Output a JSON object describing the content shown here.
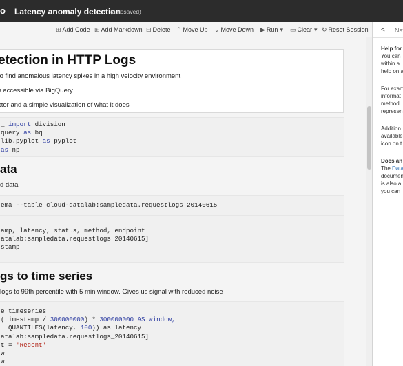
{
  "header": {
    "logo": "o",
    "title": "Latency anomaly detection",
    "autosave": "(autosaved)"
  },
  "toolbar": {
    "add_code": "Add Code",
    "add_markdown": "Add Markdown",
    "delete": "Delete",
    "move_up": "Move Up",
    "move_down": "Move Down",
    "run": "Run",
    "clear": "Clear",
    "reset": "Reset Session"
  },
  "panel": {
    "back": "<",
    "nav": "Nav",
    "lines": [
      {
        "t": "Help for",
        "bold": true
      },
      {
        "t": "You can",
        "bold": false
      },
      {
        "t": "within a",
        "bold": false
      },
      {
        "t": "help on a",
        "bold": false
      },
      {
        "t": "For exam",
        "bold": false
      },
      {
        "t": "informat",
        "bold": false
      },
      {
        "t": "method",
        "bold": false
      },
      {
        "t": "represen",
        "bold": false
      },
      {
        "t": "Addition",
        "bold": false
      },
      {
        "t": "available",
        "bold": false
      },
      {
        "t": "icon on t",
        "bold": false
      },
      {
        "t": "Docs an",
        "bold": true
      },
      {
        "t": "documen",
        "bold": false
      },
      {
        "t": "is also a",
        "bold": false
      },
      {
        "t": "you can",
        "bold": false
      }
    ],
    "the": "The",
    "data_link": "Data"
  },
  "cells": {
    "intro": {
      "heading": "etection in HTTP Logs",
      "line1": "to find anomalous latency spikes in a high velocity environment",
      "line2": "s accessible via BigQuery",
      "line3": "ctor and a simple visualization of what it does"
    },
    "imports": [
      [
        "_ ",
        "import",
        " division"
      ],
      [
        "query ",
        "as",
        " bq"
      ],
      [
        "lib.pyplot ",
        "as",
        " pyplot"
      ],
      [
        "",
        "as",
        " np"
      ]
    ],
    "data_heading": "ata",
    "data_text": "d data",
    "schema_code": "ema --table cloud-datalab:sampledata.requestlogs_20140615",
    "select_code": [
      "amp, latency, status, method, endpoint",
      "atalab:sampledata.requestlogs_20140615]",
      "stamp"
    ],
    "ts_heading": "gs to time series",
    "ts_text": "logs to 99th percentile with 5 min window. Gives us signal with reduced noise",
    "ts_code": {
      "l1": "e timeseries",
      "l2a": "(timestamp / ",
      "l2b": "300000000",
      "l2c": ") * ",
      "l2d": "300000000",
      "l2e": " AS window,",
      "l3a": "  QUANTILES(latency, ",
      "l3b": "100",
      "l3c": ")) as latency",
      "l4": "atalab:sampledata.requestlogs_20140615]",
      "l5a": "t = ",
      "l5b": "'Recent'",
      "l6": "w",
      "l7": "w"
    }
  }
}
